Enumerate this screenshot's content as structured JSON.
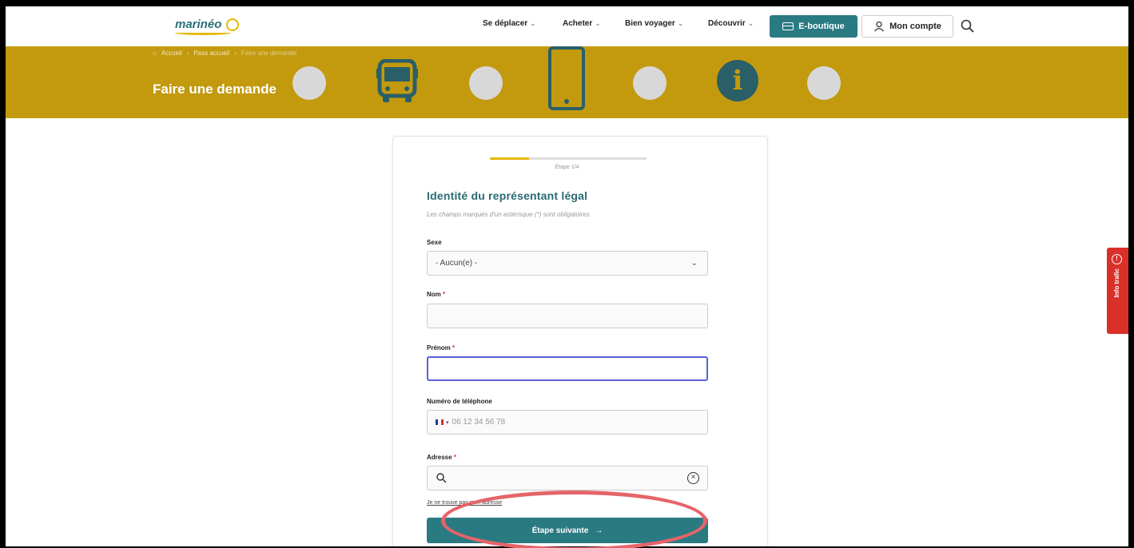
{
  "brand": {
    "logo_text": "marinéo",
    "accent": "#2a7a82",
    "banner_color": "#c39a0e",
    "highlight_color": "#e56469"
  },
  "nav": {
    "items": [
      {
        "label": "Se déplacer"
      },
      {
        "label": "Acheter"
      },
      {
        "label": "Bien voyager"
      },
      {
        "label": "Découvrir"
      }
    ],
    "eboutique_label": "E-boutique",
    "account_label": "Mon compte",
    "search_icon": "search-icon"
  },
  "banner": {
    "breadcrumb": [
      "Accueil",
      "Pass accueil",
      "Faire une demande"
    ],
    "title": "Faire une demande",
    "info_glyph": "i"
  },
  "form": {
    "progress": 0.25,
    "step_label": "Étape 1/4",
    "title": "Identité du représentant légal",
    "subtitle": "Les champs marqués d'un astérisque (*) sont obligatoires",
    "fields": {
      "sexe": {
        "label": "Sexe",
        "value": "- Aucun(e) -"
      },
      "nom": {
        "label": "Nom",
        "required": "*",
        "value": ""
      },
      "prenom": {
        "label": "Prénom",
        "required": "*",
        "value": ""
      },
      "telephone": {
        "label": "Numéro de téléphone",
        "placeholder": "06 12 34 56 78"
      },
      "adresse": {
        "label": "Adresse",
        "required": "*",
        "value": ""
      }
    },
    "address_link": "Je ne trouve pas mon adresse",
    "next_label": "Étape suivante",
    "next_arrow": "→"
  },
  "side_tab": {
    "label": "Info trafic",
    "icon_glyph": "!"
  }
}
